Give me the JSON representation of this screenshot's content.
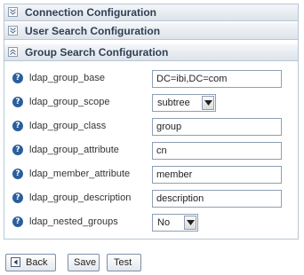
{
  "sections": [
    {
      "title": "Connection Configuration",
      "expanded": false,
      "icon": "chevron-double-down-icon"
    },
    {
      "title": "User Search Configuration",
      "expanded": false,
      "icon": "chevron-double-down-icon"
    },
    {
      "title": "Group Search Configuration",
      "expanded": true,
      "icon": "chevron-double-up-icon"
    }
  ],
  "fields": [
    {
      "label": "ldap_group_base",
      "type": "text",
      "value": "DC=ibi,DC=com"
    },
    {
      "label": "ldap_group_scope",
      "type": "select",
      "value": "subtree"
    },
    {
      "label": "ldap_group_class",
      "type": "text",
      "value": "group"
    },
    {
      "label": "ldap_group_attribute",
      "type": "text",
      "value": "cn"
    },
    {
      "label": "ldap_member_attribute",
      "type": "text",
      "value": "member"
    },
    {
      "label": "ldap_group_description",
      "type": "text",
      "value": "description"
    },
    {
      "label": "ldap_nested_groups",
      "type": "select",
      "value": "No"
    }
  ],
  "help_icon_glyph": "?",
  "buttons": {
    "back": "Back",
    "save": "Save",
    "test": "Test"
  },
  "colors": {
    "header_text": "#2f3f55",
    "help_icon": "#2a5f9e",
    "border": "#b9c6d6"
  }
}
